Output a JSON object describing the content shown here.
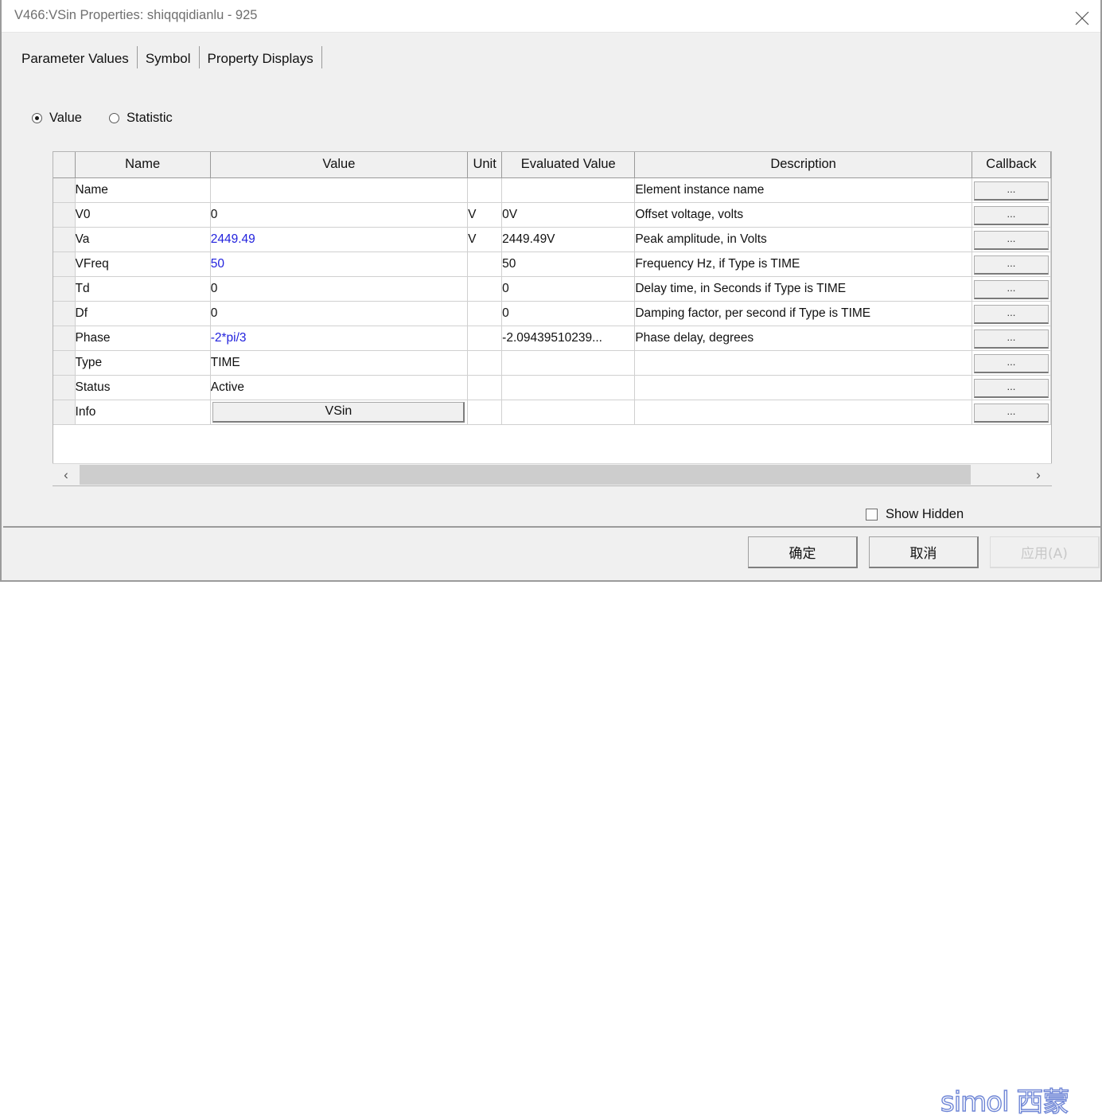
{
  "window": {
    "title": "V466:VSin Properties: shiqqqidianlu - 925",
    "close_icon": "close-icon"
  },
  "tabs": [
    {
      "label": "Parameter Values",
      "active": true
    },
    {
      "label": "Symbol",
      "active": false
    },
    {
      "label": "Property Displays",
      "active": false
    }
  ],
  "radios": [
    {
      "label": "Value",
      "checked": true
    },
    {
      "label": "Statistic",
      "checked": false
    }
  ],
  "grid": {
    "columns": [
      "",
      "Name",
      "Value",
      "Unit",
      "Evaluated Value",
      "Description",
      "Callback"
    ],
    "callback_label": "...",
    "rows": [
      {
        "name": "Name",
        "value": "",
        "value_style": "plain",
        "unit": "",
        "evaluated": "",
        "description": "Element instance name",
        "callback": "..."
      },
      {
        "name": "V0",
        "value": "0",
        "value_style": "plain",
        "unit": "V",
        "evaluated": "0V",
        "description": "Offset voltage, volts",
        "callback": "..."
      },
      {
        "name": "Va",
        "value": "2449.49",
        "value_style": "blue",
        "unit": "V",
        "evaluated": "2449.49V",
        "description": "Peak amplitude, in Volts",
        "callback": "..."
      },
      {
        "name": "VFreq",
        "value": "50",
        "value_style": "blue",
        "unit": "",
        "evaluated": "50",
        "description": "Frequency Hz, if Type is TIME",
        "callback": "..."
      },
      {
        "name": "Td",
        "value": "0",
        "value_style": "plain",
        "unit": "",
        "evaluated": "0",
        "description": "Delay time, in Seconds if Type is TIME",
        "callback": "..."
      },
      {
        "name": "Df",
        "value": "0",
        "value_style": "plain",
        "unit": "",
        "evaluated": "0",
        "description": "Damping factor, per second if Type is TIME",
        "callback": "..."
      },
      {
        "name": "Phase",
        "value": "-2*pi/3",
        "value_style": "blue",
        "unit": "",
        "evaluated": "-2.09439510239...",
        "description": "Phase delay, degrees",
        "callback": "..."
      },
      {
        "name": "Type",
        "value": "TIME",
        "value_style": "plain",
        "unit": "",
        "evaluated": "",
        "description": "",
        "callback": "..."
      },
      {
        "name": "Status",
        "value": "Active",
        "value_style": "plain",
        "unit": "",
        "evaluated": "",
        "description": "",
        "callback": "..."
      },
      {
        "name": "Info",
        "value": "VSin",
        "value_style": "button",
        "unit": "",
        "evaluated": "",
        "description": "",
        "callback": "..."
      }
    ]
  },
  "scrollbar": {
    "left_arrow": "‹",
    "right_arrow": "›"
  },
  "options": {
    "show_hidden_label": "Show Hidden",
    "show_hidden_checked": false
  },
  "footer": {
    "ok_label": "确定",
    "cancel_label": "取消",
    "apply_label": "应用(A)",
    "apply_disabled": true
  },
  "watermark": {
    "text": "simol 西蒙",
    "color": "#6f86d6"
  },
  "colors": {
    "dialog_bg": "#f0f0f0",
    "titlebar_bg": "#ffffff",
    "grid_bg": "#ffffff",
    "grid_line": "#d0d0d0",
    "header_bg": "#f0f0f0",
    "edited_value": "#2222dd",
    "scroll_thumb": "#cdcdcd"
  }
}
